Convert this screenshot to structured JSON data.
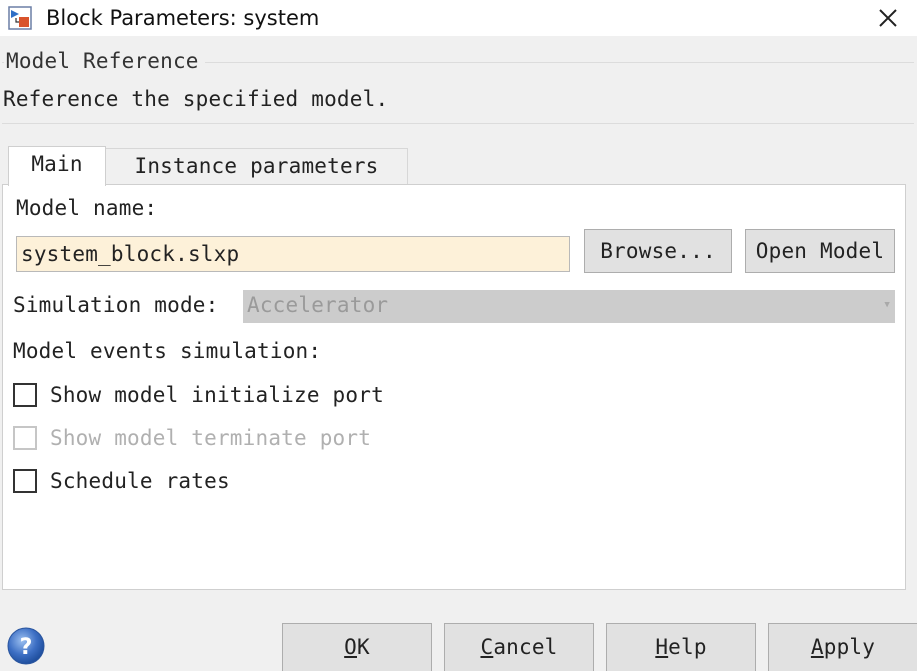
{
  "window": {
    "title": "Block Parameters: system",
    "app_icon": "simulink-block-icon",
    "close_icon": "close-icon"
  },
  "header": {
    "group_label": "Model Reference",
    "description": "Reference the specified model."
  },
  "tabs": [
    {
      "label": "Main",
      "selected": true
    },
    {
      "label": "Instance parameters",
      "selected": false
    }
  ],
  "main": {
    "model_name_label": "Model name:",
    "model_name_value": "system_block.slxp",
    "browse_label": "Browse...",
    "open_model_label": "Open Model",
    "simulation_mode_label": "Simulation mode:",
    "simulation_mode_value": "Accelerator",
    "events_label": "Model events simulation:",
    "checkboxes": [
      {
        "label": "Show model initialize port",
        "checked": false,
        "enabled": true
      },
      {
        "label": "Show model terminate port",
        "checked": false,
        "enabled": false
      },
      {
        "label": "Schedule rates",
        "checked": false,
        "enabled": true
      }
    ]
  },
  "buttons": {
    "ok": {
      "accel": "O",
      "rest": "K"
    },
    "cancel": {
      "accel": "C",
      "rest": "ancel"
    },
    "help": {
      "accel": "H",
      "rest": "elp"
    },
    "apply": {
      "accel": "A",
      "rest": "pply"
    },
    "help_icon": "question-icon"
  },
  "colors": {
    "input_background": "#fdf1d9",
    "disabled_select": "#cccccc",
    "help_icon_blue": "#3d6fc4"
  }
}
